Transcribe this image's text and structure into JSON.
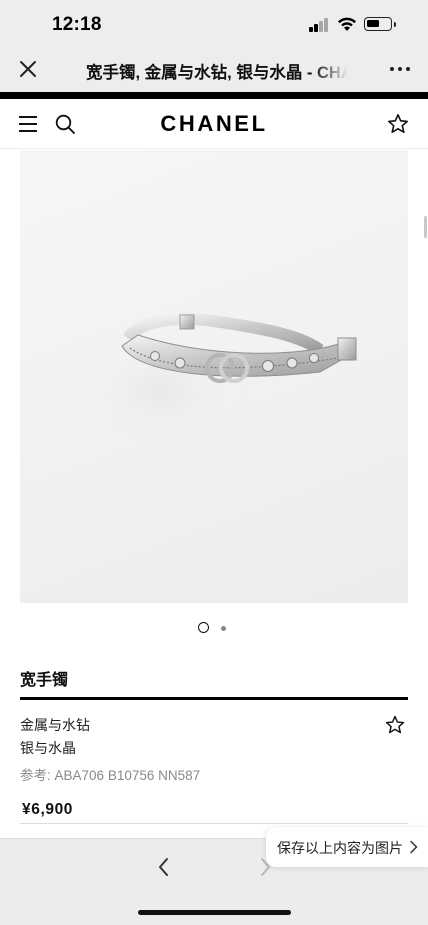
{
  "status_bar": {
    "time": "12:18"
  },
  "webview": {
    "title": "宽手镯, 金属与水钻, 银与水晶 - CHANEL",
    "close_icon": "close-icon",
    "more_icon": "more-icon"
  },
  "site_header": {
    "logo": "CHANEL",
    "menu_icon": "menu-icon",
    "search_icon": "search-icon",
    "wishlist_icon": "star-icon"
  },
  "gallery": {
    "current_index": 1,
    "total": 2
  },
  "product": {
    "name": "宽手镯",
    "material_line_1": "金属与水钻",
    "material_line_2": "银与水晶",
    "reference_label": "参考:",
    "reference_value": "ABA706 B10756 NN587",
    "price": "¥6,900"
  },
  "bottom_bar": {
    "save_tip": "保存以上内容为图片",
    "back_icon": "chevron-left-icon",
    "forward_icon": "chevron-right-icon"
  },
  "colors": {
    "accent": "#000000",
    "header_gray": "#ededed",
    "muted_text": "#8a8a8a"
  }
}
